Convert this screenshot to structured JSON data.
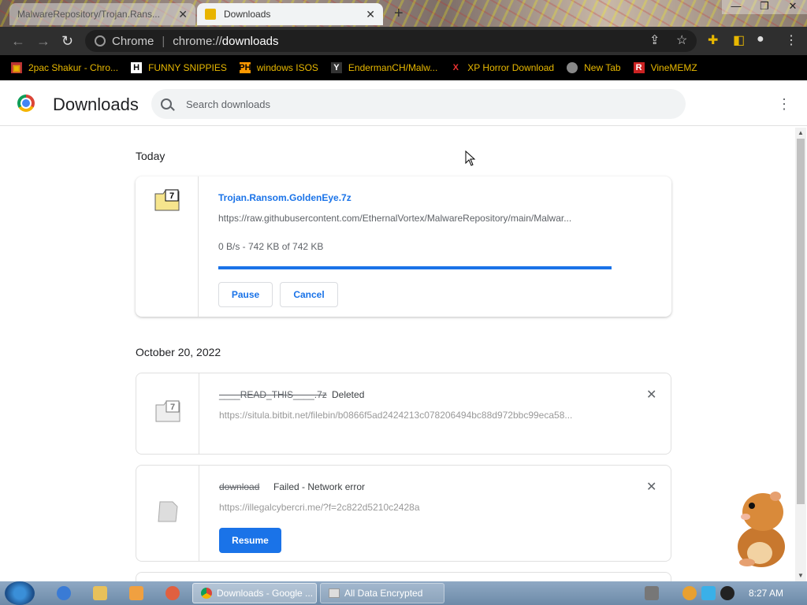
{
  "tabs": [
    {
      "title": "MalwareRepository/Trojan.Rans..."
    },
    {
      "title": "Downloads"
    }
  ],
  "omnibox": {
    "label": "Chrome",
    "url_prefix": "chrome://",
    "url_main": "downloads"
  },
  "bookmarks": [
    {
      "label": "2pac Shakur - Chro...",
      "icon": "pac-icon"
    },
    {
      "label": "FUNNY SNIPPIES",
      "icon": "h-icon"
    },
    {
      "label": "windows ISOS",
      "icon": "ph-icon"
    },
    {
      "label": "EndermanCH/Malw...",
      "icon": "yc-icon"
    },
    {
      "label": "XP Horror Download",
      "icon": "x-icon"
    },
    {
      "label": "New Tab",
      "icon": "newtab-icon"
    },
    {
      "label": "VineMEMZ",
      "icon": "r-icon"
    }
  ],
  "page": {
    "title": "Downloads",
    "search_placeholder": "Search downloads"
  },
  "groups": [
    {
      "date": "Today",
      "items": [
        {
          "filename": "Trojan.Ransom.GoldenEye.7z",
          "url": "https://raw.githubusercontent.com/EthernalVortex/MalwareRepository/main/Malwar...",
          "progress_text": "0 B/s - 742 KB of 742 KB",
          "progress": 1.0,
          "pause_label": "Pause",
          "cancel_label": "Cancel"
        }
      ]
    },
    {
      "date": "October 20, 2022",
      "items": [
        {
          "filename": "____READ_THIS____.7z",
          "status": "Deleted",
          "url": "https://situla.bitbit.net/filebin/b0866f5ad2424213c078206494bc88d972bbc99eca58..."
        },
        {
          "filename": "download",
          "status": "Failed - Network error",
          "url": "https://illegalcybercri.me/?f=2c822d5210c2428a",
          "resume_label": "Resume"
        }
      ]
    }
  ],
  "taskbar": {
    "items": [
      {
        "label": "Downloads - Google ..."
      },
      {
        "label": "All Data Encrypted"
      }
    ],
    "clock": "8:27 AM"
  },
  "colors": {
    "accent": "#1a73e8",
    "bookmark_text": "#e8b800"
  }
}
